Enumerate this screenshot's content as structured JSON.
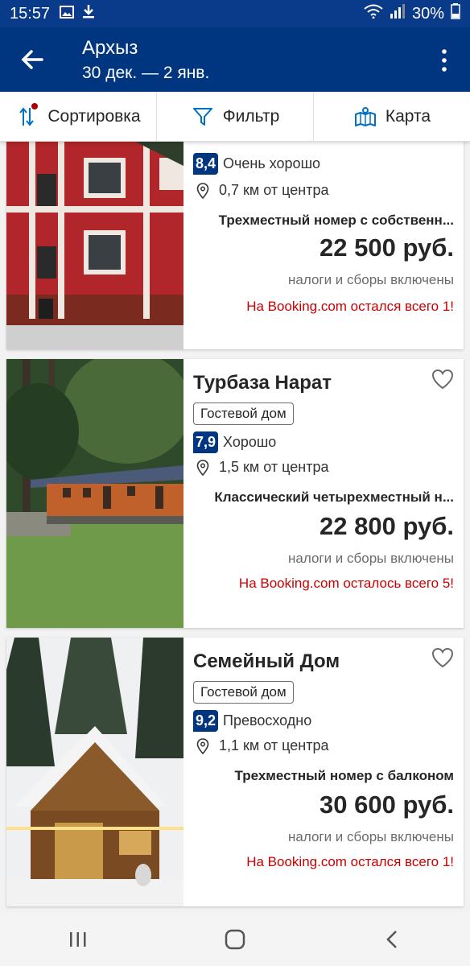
{
  "status_bar": {
    "time": "15:57",
    "battery": "30%"
  },
  "header": {
    "title": "Архыз",
    "dates": "30 дек. — 2 янв."
  },
  "toolbar": {
    "sort_label": "Сортировка",
    "filter_label": "Фильтр",
    "map_label": "Карта"
  },
  "properties": [
    {
      "name": "",
      "score": "8,4",
      "rating_text": "Очень хорошо",
      "distance": "0,7 км от центра",
      "room": "Трехместный номер с собственн...",
      "price": "22 500 руб.",
      "taxes": "налоги и сборы включены",
      "urgency": "На Booking.com остался всего 1!"
    },
    {
      "name": "Турбаза Нарат",
      "type": "Гостевой дом",
      "score": "7,9",
      "rating_text": "Хорошо",
      "distance": "1,5 км от центра",
      "room": "Классический четырехместный н...",
      "price": "22 800 руб.",
      "taxes": "налоги и сборы включены",
      "urgency": "На Booking.com осталось всего 5!"
    },
    {
      "name": "Семейный Дом",
      "type": "Гостевой дом",
      "score": "9,2",
      "rating_text": "Превосходно",
      "distance": "1,1 км от центра",
      "room": "Трехместный номер с балконом",
      "price": "30 600 руб.",
      "taxes": "налоги и сборы включены",
      "urgency": "На Booking.com остался всего 1!"
    }
  ],
  "colors": {
    "brand": "#003580",
    "status_bar": "#0a3a8a",
    "urgency": "#cc0000"
  }
}
